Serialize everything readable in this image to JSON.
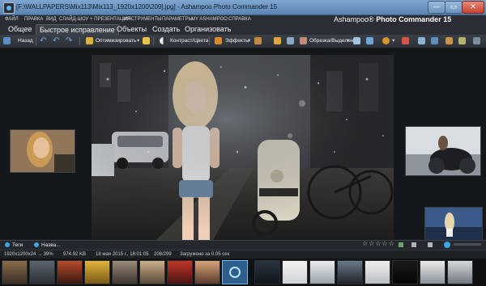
{
  "window": {
    "title": "[F:\\WALLPAPERS\\Mix113\\Mix113_1920x1200\\209].jpg] - Ashampoo Photo Commander 15",
    "minimize": "—",
    "maximize": "▭",
    "close": "✕"
  },
  "menu": {
    "items": [
      "ФАЙЛ",
      "ПРАВКА",
      "ВИД",
      "СЛАЙД-ШОУ + ПРЕЗЕНТАЦИЯ",
      "ИНСТРУМЕНТЫ",
      "ПАРАМЕТРЫ",
      "MY ASHAMPOO",
      "СПРАВКА"
    ]
  },
  "brand": {
    "prefix": "Ashampoo®",
    "name": "Photo Commander 15"
  },
  "tabs": [
    "Общее",
    "Быстрое исправление",
    "Объекты",
    "Создать",
    "Организовать"
  ],
  "active_tab": "Быстрое исправление",
  "toolbar": {
    "back": "Назад",
    "optimize": "Оптимизировать",
    "contrast": "Контраст/Цвета",
    "effects": "Эффекты",
    "crop": "Обрезка/Выделение"
  },
  "panels": {
    "tags": "Теги",
    "navigator": "Назва..."
  },
  "rating": {
    "stars_filled": 0,
    "stars_total": 5,
    "symbols": "☆☆☆☆☆"
  },
  "status": {
    "dimensions": "1920x1200x24 → 39%",
    "filesize": "974.92 KB",
    "date": "18 мая 2015 г., 18:01:05",
    "position": "208/299",
    "loaded": "Загружено за 0.05 сек"
  },
  "colors": {
    "titlebar": "#6f97c4",
    "background": "#15181b",
    "accent": "#3ba6e8",
    "selected_thumb": "#2c5f8d"
  }
}
